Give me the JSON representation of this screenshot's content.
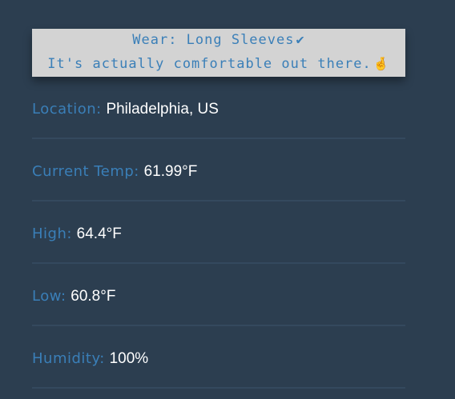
{
  "banner": {
    "line1": "Wear: Long Sleeves",
    "line1_icon": "✔",
    "line2": "It's actually comfortable out there.",
    "line2_icon": "🤞"
  },
  "rows": [
    {
      "label": "Location:",
      "value": "Philadelphia, US"
    },
    {
      "label": "Current Temp:",
      "value": "61.99°F"
    },
    {
      "label": "High:",
      "value": "64.4°F"
    },
    {
      "label": "Low:",
      "value": "60.8°F"
    },
    {
      "label": "Humidity:",
      "value": "100%"
    }
  ],
  "icons": {
    "check": "check-icon",
    "fingers": "fingers-crossed-icon"
  },
  "colors": {
    "background": "#2c3e50",
    "accent": "#3a7fb8",
    "banner_bg": "#d3d3d3",
    "divider": "#34495e",
    "value_text": "#ffffff"
  }
}
